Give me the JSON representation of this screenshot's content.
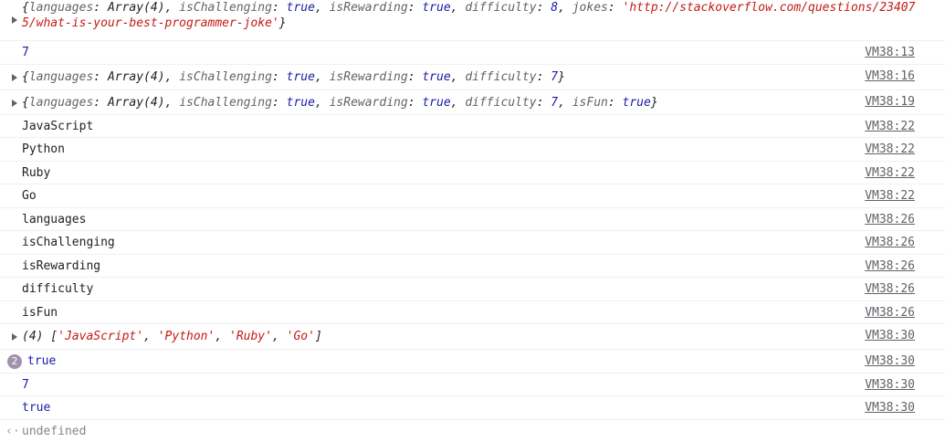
{
  "rows": [
    {
      "type": "object-expand",
      "obj_open": "{",
      "entries": [
        {
          "key": "languages",
          "value": "Array(4)",
          "vtype": "plain"
        },
        {
          "key": "isChallenging",
          "value": "true",
          "vtype": "bool"
        },
        {
          "key": "isRewarding",
          "value": "true",
          "vtype": "bool"
        },
        {
          "key": "difficulty",
          "value": "8",
          "vtype": "num"
        },
        {
          "key": "jokes",
          "value": "'http://stackoverflow.com/questions/234075/what-is-your-best-programmer-joke'",
          "vtype": "str"
        }
      ],
      "obj_close": "}",
      "source": ""
    },
    {
      "type": "simple",
      "text": "7",
      "color": "#1a1aa6",
      "source": "VM38:13"
    },
    {
      "type": "object-expand",
      "obj_open": "{",
      "entries": [
        {
          "key": "languages",
          "value": "Array(4)",
          "vtype": "plain"
        },
        {
          "key": "isChallenging",
          "value": "true",
          "vtype": "bool"
        },
        {
          "key": "isRewarding",
          "value": "true",
          "vtype": "bool"
        },
        {
          "key": "difficulty",
          "value": "7",
          "vtype": "num"
        }
      ],
      "obj_close": "}",
      "source": "VM38:16"
    },
    {
      "type": "object-expand",
      "obj_open": "{",
      "entries": [
        {
          "key": "languages",
          "value": "Array(4)",
          "vtype": "plain"
        },
        {
          "key": "isChallenging",
          "value": "true",
          "vtype": "bool"
        },
        {
          "key": "isRewarding",
          "value": "true",
          "vtype": "bool"
        },
        {
          "key": "difficulty",
          "value": "7",
          "vtype": "num"
        },
        {
          "key": "isFun",
          "value": "true",
          "vtype": "bool"
        }
      ],
      "obj_close": "}",
      "source": "VM38:19"
    },
    {
      "type": "simple",
      "text": "JavaScript",
      "color": "#202124",
      "source": "VM38:22"
    },
    {
      "type": "simple",
      "text": "Python",
      "color": "#202124",
      "source": "VM38:22"
    },
    {
      "type": "simple",
      "text": "Ruby",
      "color": "#202124",
      "source": "VM38:22"
    },
    {
      "type": "simple",
      "text": "Go",
      "color": "#202124",
      "source": "VM38:22"
    },
    {
      "type": "simple",
      "text": "languages",
      "color": "#202124",
      "source": "VM38:26"
    },
    {
      "type": "simple",
      "text": "isChallenging",
      "color": "#202124",
      "source": "VM38:26"
    },
    {
      "type": "simple",
      "text": "isRewarding",
      "color": "#202124",
      "source": "VM38:26"
    },
    {
      "type": "simple",
      "text": "difficulty",
      "color": "#202124",
      "source": "VM38:26"
    },
    {
      "type": "simple",
      "text": "isFun",
      "color": "#202124",
      "source": "VM38:26"
    },
    {
      "type": "array-expand",
      "prefix": "(4)",
      "items": [
        "'JavaScript'",
        "'Python'",
        "'Ruby'",
        "'Go'"
      ],
      "source": "VM38:30"
    },
    {
      "type": "badge",
      "count": "2",
      "text": "true",
      "color": "#1a1aa6",
      "source": "VM38:30"
    },
    {
      "type": "simple",
      "text": "7",
      "color": "#1a1aa6",
      "source": "VM38:30"
    },
    {
      "type": "simple",
      "text": "true",
      "color": "#1a1aa6",
      "source": "VM38:30"
    },
    {
      "type": "return",
      "arrow": "‹·",
      "text": "undefined",
      "color": "#80868b"
    }
  ]
}
